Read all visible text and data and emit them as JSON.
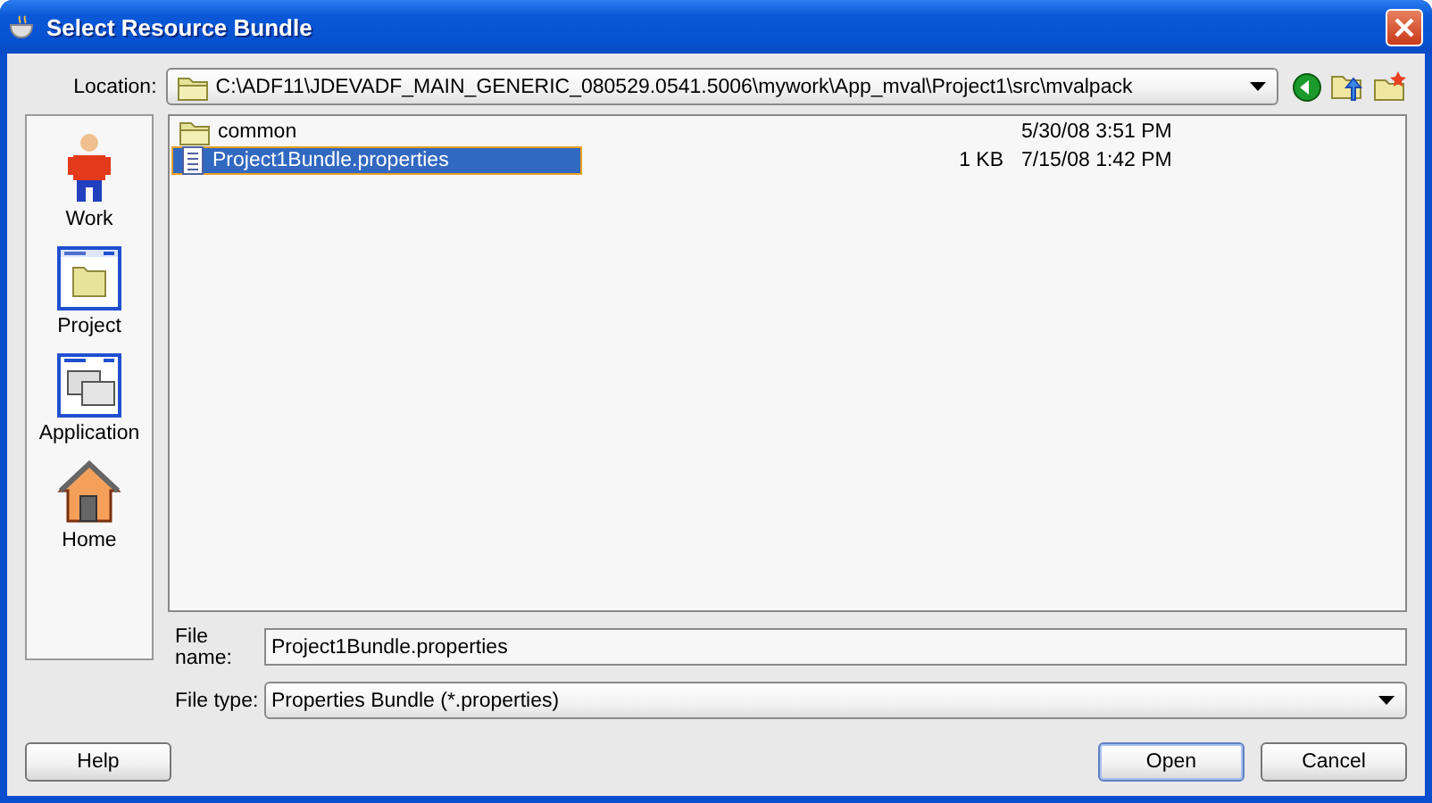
{
  "window": {
    "title": "Select Resource Bundle"
  },
  "location": {
    "label": "Location:",
    "value": "C:\\ADF11\\JDEVADF_MAIN_GENERIC_080529.0541.5006\\mywork\\App_mval\\Project1\\src\\mvalpack"
  },
  "places": [
    {
      "label": "Work",
      "kind": "person"
    },
    {
      "label": "Project",
      "kind": "project"
    },
    {
      "label": "Application",
      "kind": "application"
    },
    {
      "label": "Home",
      "kind": "home"
    }
  ],
  "files": [
    {
      "name": "common",
      "kind": "folder",
      "modified": "5/30/08 3:51 PM",
      "selected": false
    },
    {
      "name": "Project1Bundle.properties",
      "kind": "file",
      "size": "1 KB",
      "modified": "7/15/08 1:42 PM",
      "selected": true
    }
  ],
  "file_name": {
    "label": "File name:",
    "value": "Project1Bundle.properties"
  },
  "file_type": {
    "label": "File type:",
    "value": "Properties Bundle (*.properties)"
  },
  "buttons": [
    {
      "label": "Help",
      "default": false
    },
    {
      "label": "Open",
      "default": true
    },
    {
      "label": "Cancel",
      "default": false
    }
  ]
}
